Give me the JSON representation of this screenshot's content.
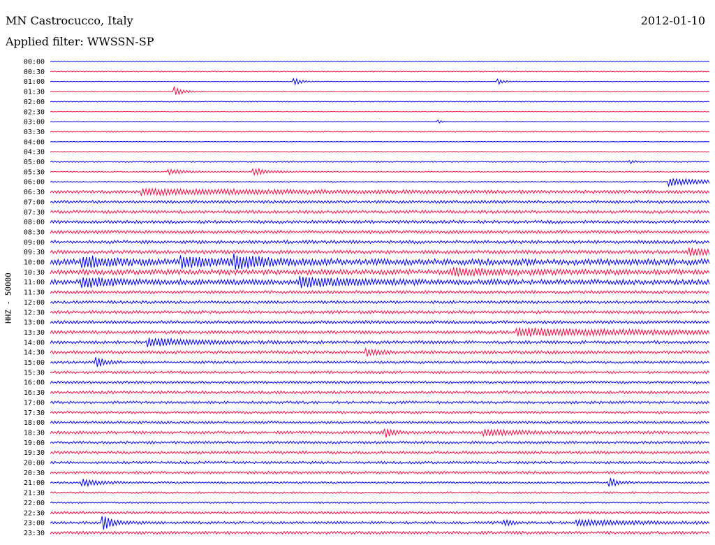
{
  "header": {
    "station": "MN Castrocucco, Italy",
    "date": "2012-01-10",
    "filter": "Applied filter: WWSSN-SP"
  },
  "colors": {
    "even": "#0000ee",
    "odd": "#ee1144"
  },
  "chart_data": {
    "type": "line",
    "ylabel": "HHZ - 50000",
    "row_labels": [
      "00:00",
      "00:30",
      "01:00",
      "01:30",
      "02:00",
      "02:30",
      "03:00",
      "03:30",
      "04:00",
      "04:30",
      "05:00",
      "05:30",
      "06:00",
      "06:30",
      "07:00",
      "07:30",
      "08:00",
      "08:30",
      "09:00",
      "09:30",
      "10:00",
      "10:30",
      "11:00",
      "11:30",
      "12:00",
      "12:30",
      "13:00",
      "13:30",
      "14:00",
      "14:30",
      "15:00",
      "15:30",
      "16:00",
      "16:30",
      "17:00",
      "17:30",
      "18:00",
      "18:30",
      "19:00",
      "19:30",
      "20:00",
      "20:30",
      "21:00",
      "21:30",
      "22:00",
      "22:30",
      "23:00",
      "23:30"
    ],
    "noise": [
      0.6,
      1.0,
      0.6,
      0.7,
      1.0,
      0.6,
      0.7,
      1.0,
      0.6,
      0.7,
      1.2,
      1.0,
      1.2,
      3.0,
      2.8,
      3.0,
      3.0,
      3.0,
      3.2,
      3.5,
      6.0,
      5.0,
      5.0,
      3.0,
      2.8,
      3.0,
      3.0,
      3.0,
      3.0,
      3.0,
      2.5,
      2.5,
      2.5,
      2.8,
      2.5,
      2.5,
      2.5,
      2.8,
      2.5,
      2.8,
      2.5,
      2.5,
      2.0,
      1.8,
      1.5,
      2.5,
      2.5,
      2.8
    ],
    "events": [
      {
        "row": 2,
        "t": 0.37,
        "amp": 12,
        "dur": 0.01
      },
      {
        "row": 2,
        "t": 0.68,
        "amp": 8,
        "dur": 0.008
      },
      {
        "row": 3,
        "t": 0.19,
        "amp": 14,
        "dur": 0.012
      },
      {
        "row": 6,
        "t": 0.59,
        "amp": 4,
        "dur": 0.006
      },
      {
        "row": 10,
        "t": 0.88,
        "amp": 4,
        "dur": 0.01
      },
      {
        "row": 11,
        "t": 0.18,
        "amp": 8,
        "dur": 0.025
      },
      {
        "row": 11,
        "t": 0.31,
        "amp": 10,
        "dur": 0.025
      },
      {
        "row": 12,
        "t": 0.94,
        "amp": 11,
        "dur": 0.06
      },
      {
        "row": 13,
        "t": 0.14,
        "amp": 7,
        "dur": 0.24
      },
      {
        "row": 19,
        "t": 0.97,
        "amp": 10,
        "dur": 0.04
      },
      {
        "row": 20,
        "t": 0.05,
        "amp": 12,
        "dur": 0.05
      },
      {
        "row": 20,
        "t": 0.2,
        "amp": 12,
        "dur": 0.06
      },
      {
        "row": 20,
        "t": 0.28,
        "amp": 14,
        "dur": 0.05
      },
      {
        "row": 21,
        "t": 0.61,
        "amp": 8,
        "dur": 0.08
      },
      {
        "row": 22,
        "t": 0.05,
        "amp": 12,
        "dur": 0.05
      },
      {
        "row": 22,
        "t": 0.38,
        "amp": 12,
        "dur": 0.08
      },
      {
        "row": 27,
        "t": 0.71,
        "amp": 10,
        "dur": 0.22
      },
      {
        "row": 28,
        "t": 0.15,
        "amp": 12,
        "dur": 0.06
      },
      {
        "row": 29,
        "t": 0.48,
        "amp": 10,
        "dur": 0.02
      },
      {
        "row": 30,
        "t": 0.07,
        "amp": 18,
        "dur": 0.012
      },
      {
        "row": 37,
        "t": 0.51,
        "amp": 12,
        "dur": 0.012
      },
      {
        "row": 37,
        "t": 0.66,
        "amp": 8,
        "dur": 0.05
      },
      {
        "row": 42,
        "t": 0.05,
        "amp": 9,
        "dur": 0.03
      },
      {
        "row": 42,
        "t": 0.85,
        "amp": 12,
        "dur": 0.012
      },
      {
        "row": 46,
        "t": 0.08,
        "amp": 22,
        "dur": 0.015
      },
      {
        "row": 46,
        "t": 0.8,
        "amp": 8,
        "dur": 0.08
      },
      {
        "row": 46,
        "t": 0.69,
        "amp": 7,
        "dur": 0.01
      }
    ]
  }
}
